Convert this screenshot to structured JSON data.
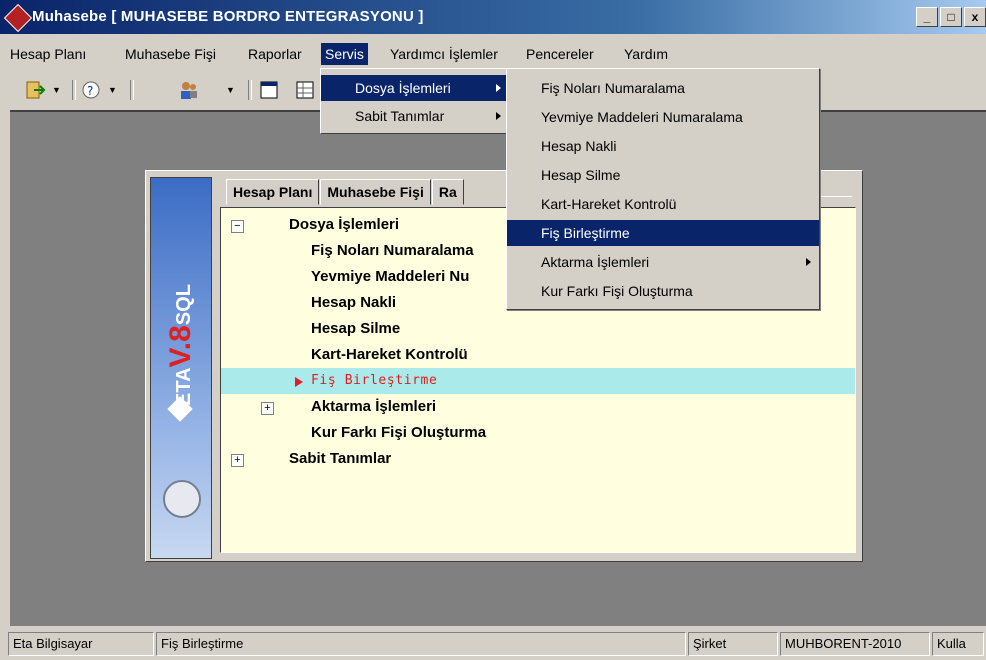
{
  "window": {
    "title": "Muhasebe [ MUHASEBE BORDRO ENTEGRASYONU ]",
    "minimize": "_",
    "maximize": "□",
    "close": "x"
  },
  "menubar": [
    "Hesap Planı",
    "Muhasebe Fişi",
    "Raporlar",
    "Servis",
    "Yardımcı İşlemler",
    "Pencereler",
    "Yardım"
  ],
  "menubar_active": "Servis",
  "servis_menu": [
    "Dosya İşlemleri",
    "Sabit Tanımlar"
  ],
  "dosya_submenu": [
    "Fiş Noları Numaralama",
    "Yevmiye Maddeleri Numaralama",
    "Hesap Nakli",
    "Hesap Silme",
    "Kart-Hareket Kontrolü",
    "Fiş Birleştirme",
    "Aktarma İşlemleri",
    "Kur Farkı Fişi Oluşturma"
  ],
  "dosya_submenu_active": "Fiş Birleştirme",
  "tabs": [
    "Hesap Planı",
    "Muhasebe Fişi",
    "Ra"
  ],
  "tree": [
    {
      "label": "Dosya İşlemleri",
      "toggle": "−"
    },
    {
      "label": "Fiş Noları Numaralama"
    },
    {
      "label": "Yevmiye Maddeleri Nu"
    },
    {
      "label": "Hesap Nakli"
    },
    {
      "label": "Hesap Silme"
    },
    {
      "label": "Kart-Hareket Kontrolü"
    },
    {
      "label": "Fiş Birleştirme",
      "selected": true
    },
    {
      "label": "Aktarma İşlemleri",
      "toggle": "+"
    },
    {
      "label": "Kur Farkı Fişi Oluşturma"
    },
    {
      "label": "Sabit Tanımlar",
      "toggle": "+"
    }
  ],
  "logo": {
    "brand": "ETA",
    "version": "V.8",
    "suffix": "SQL"
  },
  "statusbar": [
    "Eta Bilgisayar",
    "Fiş Birleştirme",
    "Şirket",
    "MUHBORENT-2010",
    "Kulla"
  ],
  "icons": [
    "exit-icon",
    "help-icon",
    "users-icon",
    "window-icon",
    "grid-icon",
    "diamond-logo-icon",
    "clock-icon"
  ],
  "colors": {
    "title_start": "#0a246a",
    "title_end": "#a6caf0",
    "highlight": "#0a246a",
    "tree_bg": "#ffffe0",
    "tree_selected": "#aaeaea",
    "accent_red": "#e02020"
  }
}
